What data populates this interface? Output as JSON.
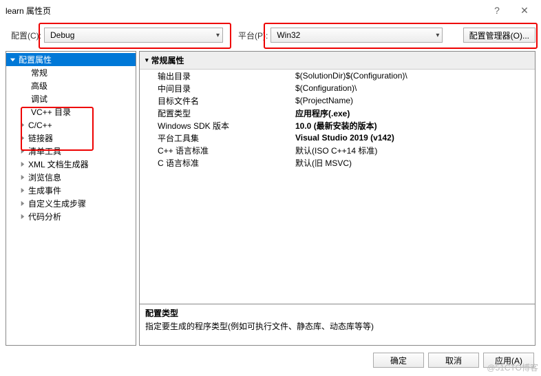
{
  "window": {
    "title": "learn 属性页"
  },
  "toolbar": {
    "config_label": "配置(C):",
    "config_value": "Debug",
    "platform_label": "平台(P):",
    "platform_value": "Win32",
    "manager_btn": "配置管理器(O)..."
  },
  "tree": {
    "root": "配置属性",
    "items": [
      "常规",
      "高级",
      "调试",
      "VC++ 目录",
      "C/C++",
      "链接器",
      "清单工具",
      "XML 文档生成器",
      "浏览信息",
      "生成事件",
      "自定义生成步骤",
      "代码分析"
    ]
  },
  "section_header": "常规属性",
  "props": [
    {
      "k": "输出目录",
      "v": "$(SolutionDir)$(Configuration)\\"
    },
    {
      "k": "中间目录",
      "v": "$(Configuration)\\"
    },
    {
      "k": "目标文件名",
      "v": "$(ProjectName)"
    },
    {
      "k": "配置类型",
      "v": "应用程序(.exe)",
      "bold": true,
      "sel": true
    },
    {
      "k": "Windows SDK 版本",
      "v": "10.0 (最新安装的版本)",
      "bold": true
    },
    {
      "k": "平台工具集",
      "v": "Visual Studio 2019 (v142)",
      "bold": true
    },
    {
      "k": "C++ 语言标准",
      "v": "默认(ISO C++14 标准)"
    },
    {
      "k": "C 语言标准",
      "v": "默认(旧 MSVC)"
    }
  ],
  "desc": {
    "title": "配置类型",
    "body": "指定要生成的程序类型(例如可执行文件、静态库、动态库等等)"
  },
  "footer": {
    "ok": "确定",
    "cancel": "取消",
    "apply": "应用(A)"
  },
  "watermark": "@51CTO博客"
}
